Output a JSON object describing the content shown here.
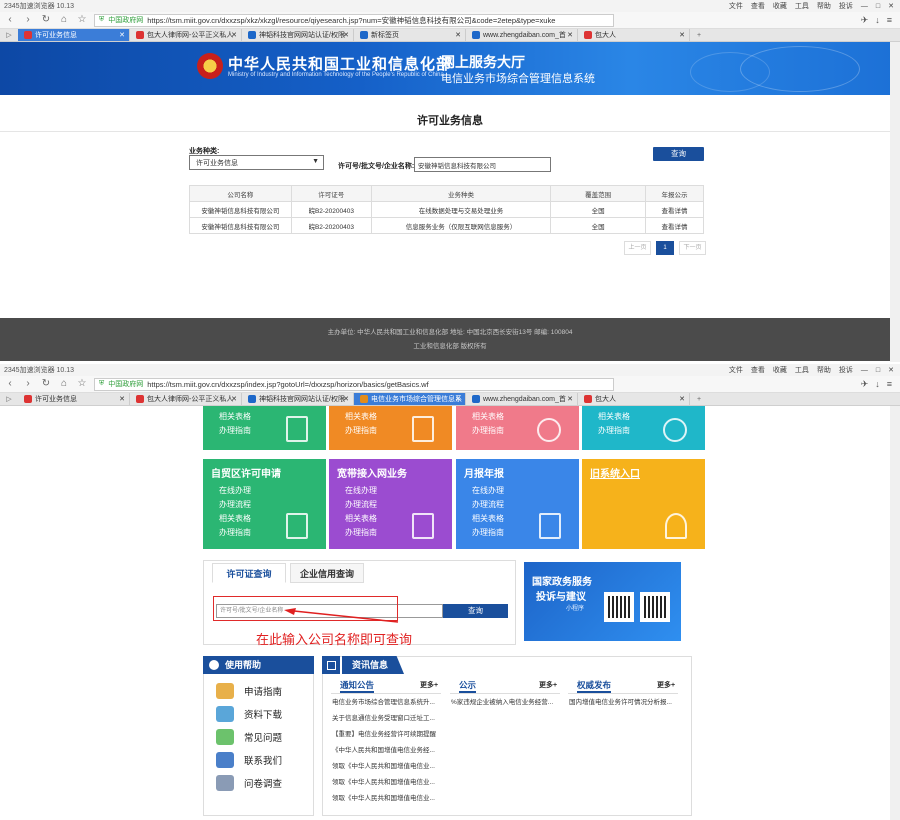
{
  "browser1": {
    "app_title": "2345加速浏览器 10.13",
    "menu": [
      "文件",
      "查看",
      "收藏",
      "工具",
      "帮助",
      "投诉"
    ],
    "safe_label": "中国政府网",
    "url": "https://tsm.miit.gov.cn/dxxzsp/xkz/xkzgl/resource/qiyesearch.jsp?num=安徽神韬信息科技有限公司&code=2etep&type=xuke",
    "tabs": [
      "许可业务信息",
      "包大人律师网-公平正义私人",
      "神韬科技官网网站认证/权限",
      "新标签页",
      "www.zhengdaiban.com_首",
      "包大人"
    ]
  },
  "banner": {
    "ministry": "中华人民共和国工业和信息化部",
    "ministry_en": "Ministry of Industry and Information Technology of the People's Republic of China",
    "service_hall": "网上服务大厅",
    "system_name": "电信业务市场综合管理信息系统"
  },
  "search_page": {
    "title": "许可业务信息",
    "type_label": "业务种类:",
    "type_value": "许可业务信息",
    "query_label": "许可号/批文号/企业名称:",
    "query_value": "安徽神韬信息科技有限公司",
    "search_button": "查询",
    "columns": [
      "公司名称",
      "许可证号",
      "业务种类",
      "覆盖范围",
      "年报公示"
    ],
    "rows": [
      [
        "安徽神韬信息科技有限公司",
        "皖B2-20200403",
        "在线数据处理与交易处理业务",
        "全国",
        "查看详情"
      ],
      [
        "安徽神韬信息科技有限公司",
        "皖B2-20200403",
        "信息服务业务（仅限互联网信息服务）",
        "全国",
        "查看详情"
      ]
    ],
    "pager": {
      "prev": "上一页",
      "current": "1",
      "next": "下一页"
    }
  },
  "footer": {
    "line1": "主办单位: 中华人民共和国工业和信息化部 地址: 中国北京西长安街13号 邮编: 100804",
    "line2": "工业和信息化部 版权所有"
  },
  "browser2": {
    "app_title": "2345加速浏览器 10.13",
    "safe_label": "中国政府网",
    "url": "https://tsm.miit.gov.cn/dxxzsp/index.jsp?gotoUrl=/dxxzsp/horizon/basics/getBasics.wf",
    "tabs": [
      "许可业务信息",
      "包大人律师网-公平正义私人",
      "神韬科技官网网站认证/权限",
      "电信业务市场综合管理信息系",
      "www.zhengdaiban.com_首",
      "包大人"
    ]
  },
  "tiles_top": [
    {
      "line1": "相关表格",
      "line2": "办理指南",
      "color": "#2bb673"
    },
    {
      "line1": "相关表格",
      "line2": "办理指南",
      "color": "#f08a24"
    },
    {
      "line1": "相关表格",
      "line2": "办理指南",
      "color": "#f07a8a"
    },
    {
      "line1": "相关表格",
      "line2": "办理指南",
      "color": "#1fb7c9"
    }
  ],
  "tiles_mid": [
    {
      "title": "自贸区许可申请",
      "items": [
        "在线办理",
        "办理流程",
        "相关表格",
        "办理指南"
      ],
      "color": "#2bb673"
    },
    {
      "title": "宽带接入网业务",
      "items": [
        "在线办理",
        "办理流程",
        "相关表格",
        "办理指南"
      ],
      "color": "#9b4cd0"
    },
    {
      "title": "月报年报",
      "items": [
        "在线办理",
        "办理流程",
        "相关表格",
        "办理指南"
      ],
      "color": "#3a86e8"
    },
    {
      "title": "旧系统入口",
      "items": [],
      "color": "#f6b21b"
    }
  ],
  "license_panel": {
    "tab1": "许可证查询",
    "tab2": "企业信用查询",
    "placeholder": "许可号/批文号/企业名称",
    "button": "查询",
    "annotation": "在此输入公司名称即可查询"
  },
  "ad": {
    "line1": "国家政务服务",
    "line2": "投诉与建议",
    "line3": "小程序"
  },
  "help": {
    "title": "使用帮助",
    "items": [
      "申请指南",
      "资料下载",
      "常见问题",
      "联系我们",
      "问卷调查"
    ]
  },
  "news": {
    "title": "资讯信息",
    "more": "更多+",
    "col1": {
      "title": "通知公告",
      "items": [
        "电信业务市场综合管理信息系统升...",
        "关于信息通信业务受理窗口迁址工...",
        "【重要】电信业务经营许可续期提醒",
        "《中华人民共和国增值电信业务经...",
        "领取《中华人民共和国增值电信业...",
        "领取《中华人民共和国增值电信业...",
        "领取《中华人民共和国增值电信业..."
      ]
    },
    "col2": {
      "title": "公示",
      "items": [
        "%家违规企业被纳入电信业务经营..."
      ]
    },
    "col3": {
      "title": "权威发布",
      "items": [
        "国内增值电信业务许可情况分析报..."
      ]
    }
  }
}
